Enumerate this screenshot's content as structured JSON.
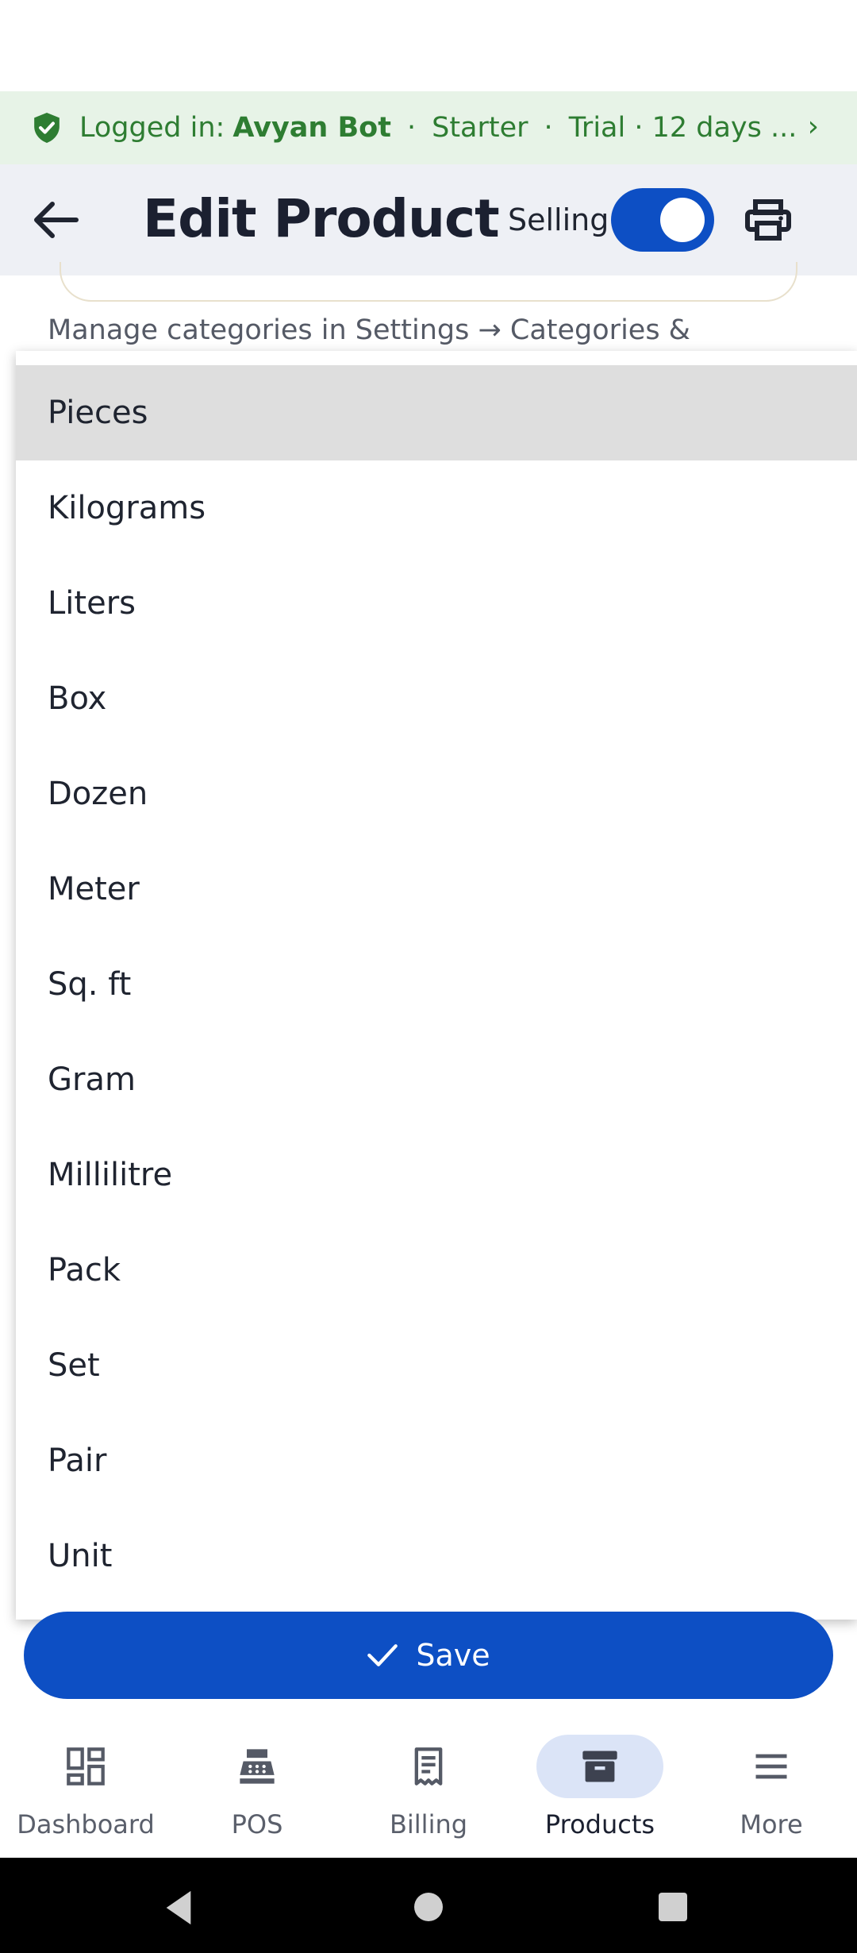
{
  "login_banner": {
    "prefix": "Logged in:",
    "user": "Avyan Bot",
    "plan": "Starter",
    "trial": "Trial · 12 days ...",
    "separator": "·",
    "chevron": "›"
  },
  "app_bar": {
    "title": "Edit Product",
    "selling_label": "Selling",
    "selling_enabled": true
  },
  "helper_text": "Manage categories in Settings → Categories &",
  "unit_dropdown": {
    "selected": "Pieces",
    "options": [
      "Pieces",
      "Kilograms",
      "Liters",
      "Box",
      "Dozen",
      "Meter",
      "Sq. ft",
      "Gram",
      "Millilitre",
      "Pack",
      "Set",
      "Pair",
      "Unit"
    ]
  },
  "save_button": {
    "label": "Save"
  },
  "bottom_nav": {
    "items": [
      {
        "label": "Dashboard",
        "icon": "dashboard-icon"
      },
      {
        "label": "POS",
        "icon": "cash-register-icon"
      },
      {
        "label": "Billing",
        "icon": "receipt-icon"
      },
      {
        "label": "Products",
        "icon": "archive-box-icon",
        "active": true
      },
      {
        "label": "More",
        "icon": "menu-icon"
      }
    ]
  },
  "colors": {
    "primary": "#0d4fc4",
    "banner_bg": "#e7f3e7",
    "banner_text": "#2e7d32",
    "app_bar_bg": "#eef0f5",
    "selected_option_bg": "#dedede"
  }
}
